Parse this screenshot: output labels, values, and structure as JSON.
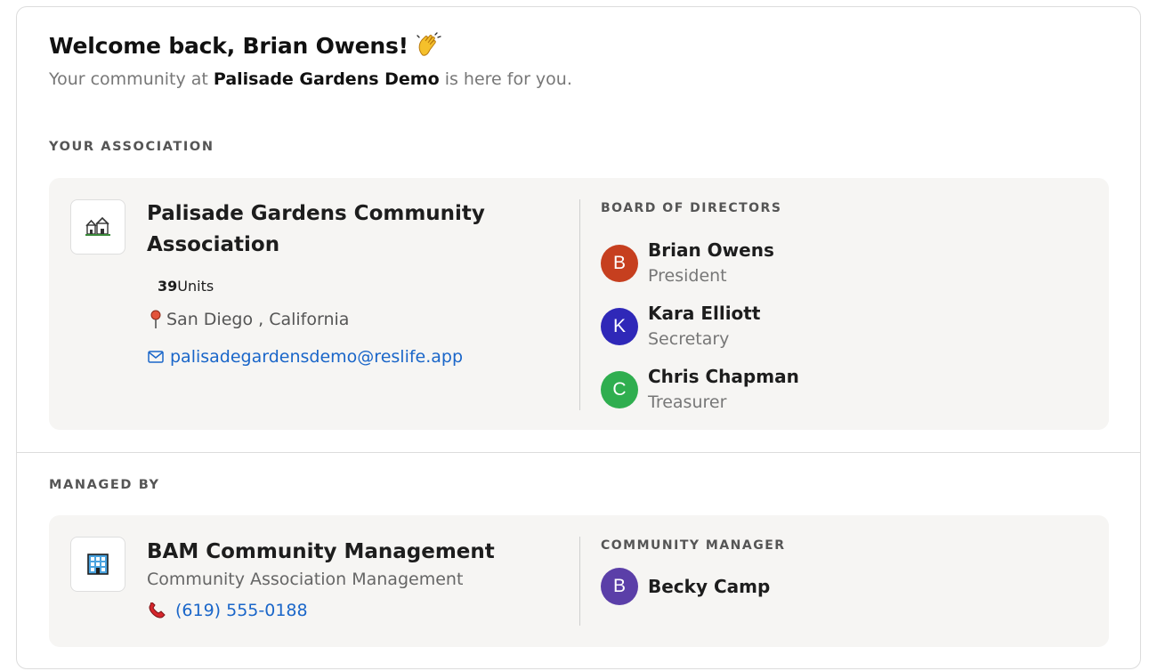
{
  "welcome": {
    "greeting": "Welcome back, Brian Owens!",
    "subtitle_prefix": "Your community at ",
    "community_name": "Palisade Gardens Demo",
    "subtitle_suffix": " is here for you."
  },
  "association": {
    "section_label": "YOUR ASSOCIATION",
    "name_line1": "Palisade Gardens Community",
    "name_line2": "Association",
    "units_count": "39",
    "units_label": "Units",
    "location": "San Diego , California",
    "email": "palisadegardensdemo@reslife.app",
    "board_label": "BOARD OF DIRECTORS",
    "board": [
      {
        "initial": "B",
        "name": "Brian Owens",
        "role": "President",
        "color": "#c63f1f"
      },
      {
        "initial": "K",
        "name": "Kara Elliott",
        "role": "Secretary",
        "color": "#2f28b8"
      },
      {
        "initial": "C",
        "name": "Chris Chapman",
        "role": "Treasurer",
        "color": "#2fae4f"
      }
    ]
  },
  "management": {
    "section_label": "MANAGED BY",
    "name": "BAM Community Management",
    "description": "Community Association Management",
    "phone": "(619) 555-0188",
    "manager_label": "COMMUNITY MANAGER",
    "manager": {
      "initial": "B",
      "name": "Becky Camp",
      "color": "#5b3fa8"
    }
  },
  "icons": {
    "wave": "waving-hand-icon",
    "association_logo": "houses-icon",
    "location": "pin-icon",
    "email": "mail-icon",
    "management_logo": "office-building-icon",
    "phone": "telephone-icon"
  }
}
